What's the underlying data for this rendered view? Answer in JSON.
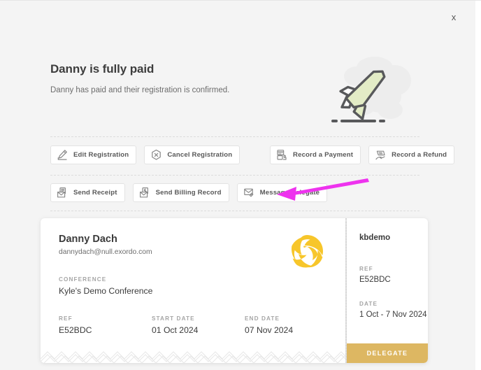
{
  "modal": {
    "close_label": "x",
    "close_icon": "close-x-icon"
  },
  "hero": {
    "title": "Danny is fully paid",
    "subtitle": "Danny has paid and their registration is confirmed.",
    "illustration_icon": "airplane-illustration",
    "illustration_plane_fill": "#e3ecc6",
    "illustration_plane_stroke": "#58595b",
    "illustration_cloud_fill": "#ededed"
  },
  "actions": {
    "primary_row": [
      {
        "label": "Edit Registration",
        "icon": "edit-pencil-icon"
      },
      {
        "label": "Cancel Registration",
        "icon": "cancel-hexagon-x-icon"
      }
    ],
    "finance_row": [
      {
        "label": "Record a Payment",
        "icon": "cash-register-icon"
      },
      {
        "label": "Record a Refund",
        "icon": "refund-hand-icon"
      }
    ],
    "message_row": [
      {
        "label": "Send Receipt",
        "icon": "envelope-receipt-icon"
      },
      {
        "label": "Send Billing Record",
        "icon": "envelope-billing-icon"
      },
      {
        "label": "Message Delegate",
        "icon": "envelope-pencil-icon"
      }
    ]
  },
  "ticket": {
    "name": "Danny Dach",
    "email": "dannydach@null.exordo.com",
    "logo_icon": "exordo-swirl-logo",
    "logo_color": "#f7c62b",
    "conference_label": "CONFERENCE",
    "conference_value": "Kyle's Demo Conference",
    "ref_label": "REF",
    "ref_value": "E52BDC",
    "start_date_label": "START DATE",
    "start_date_value": "01 Oct 2024",
    "end_date_label": "END DATE",
    "end_date_value": "07 Nov 2024"
  },
  "stub": {
    "title": "kbdemo",
    "ref_label": "REF",
    "ref_value": "E52BDC",
    "date_label": "DATE",
    "date_value": "1 Oct - 7 Nov 2024",
    "badge_label": "DELEGATE",
    "badge_color": "#ddb762"
  },
  "annotation": {
    "arrow_color": "#ee33ee",
    "points_at": "Message Delegate"
  }
}
